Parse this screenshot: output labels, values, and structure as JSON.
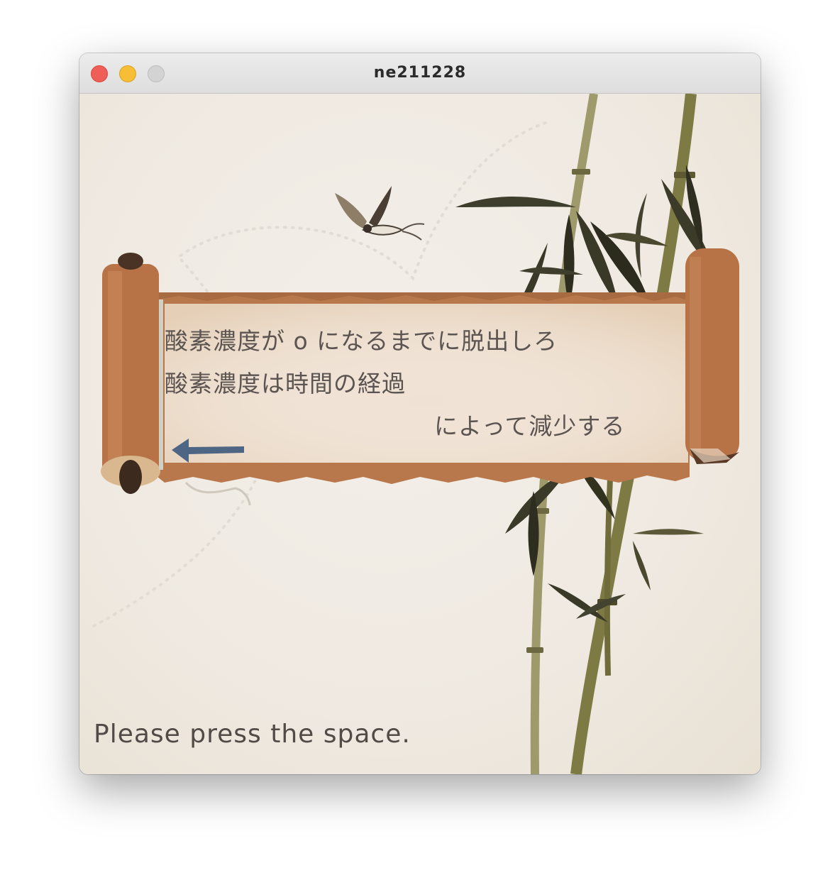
{
  "window": {
    "title": "ne211228"
  },
  "scroll": {
    "line1": "酸素濃度が o になるまでに脱出しろ",
    "line2": "酸素濃度は時間の経過",
    "line3": "によって減少する"
  },
  "prompt": "Please press the space.",
  "icons": {
    "back_arrow": "left-arrow-icon",
    "bird": "swallow-bird",
    "bamboo": "bamboo-stalks"
  },
  "colors": {
    "scroll_brown": "#b87549",
    "paper": "#f3e7da",
    "text": "#5b5450",
    "arrow": "#4e6684",
    "bamboo_dark": "#3c3a28",
    "bamboo_stem": "#8a8650"
  }
}
